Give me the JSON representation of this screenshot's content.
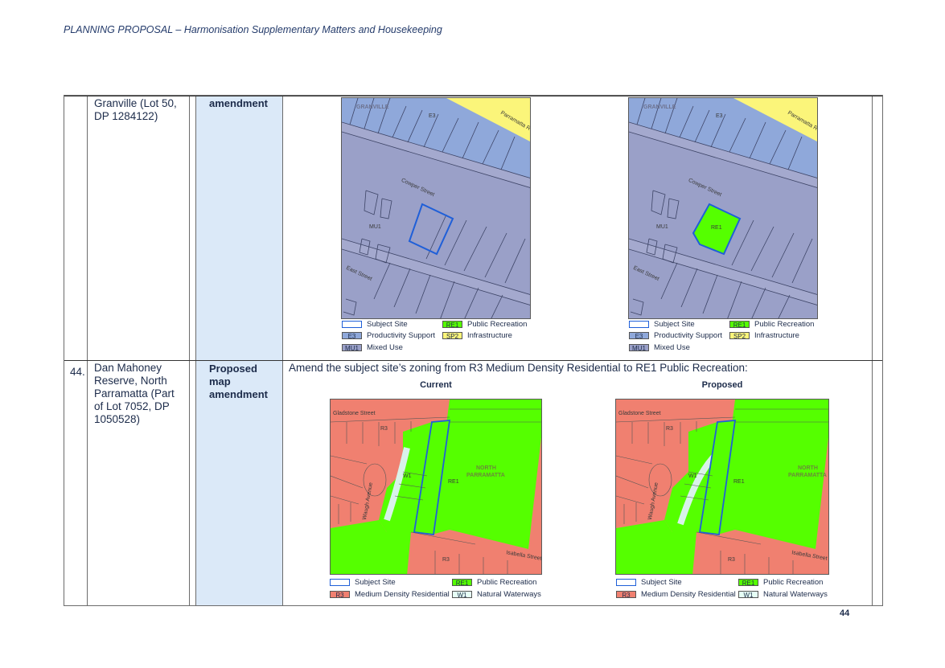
{
  "header": {
    "title": "PLANNING PROPOSAL – Harmonisation Supplementary Matters and Housekeeping"
  },
  "page_number": "44",
  "rows": [
    {
      "number": "",
      "site_lines": [
        "Granville (Lot 50,",
        "DP 1284122)"
      ],
      "type_lines": [
        "amendment"
      ],
      "maps": {
        "current": {
          "labels": {
            "granville": "GRANVILLE",
            "e3": "E3",
            "parramatta": "Parramatta R",
            "cowper": "Cowper Street",
            "mu1": "MU1",
            "east": "East Street"
          }
        },
        "proposed": {
          "labels": {
            "granville": "GRANVILLE",
            "e3": "E3",
            "parramatta": "Parramatta R",
            "cowper": "Cowper Street",
            "mu1": "MU1",
            "re1": "RE1",
            "east": "East Street"
          }
        }
      },
      "legend": {
        "subject_site": "Subject Site",
        "re1_code": "RE1",
        "re1_label": "Public Recreation",
        "e3_code": "E3",
        "e3_label": "Productivity Support",
        "sp2_code": "SP2",
        "sp2_label": "Infrastructure",
        "mu1_code": "MU1",
        "mu1_label": "Mixed Use"
      }
    },
    {
      "number": "44.",
      "site_lines": [
        "Dan Mahoney",
        "Reserve, North",
        "Parramatta (Part",
        "of Lot 7052, DP",
        "1050528)"
      ],
      "type_lines": [
        "Proposed",
        "map",
        "amendment"
      ],
      "description": "Amend the subject site’s zoning from R3 Medium Density Residential to RE1 Public Recreation:",
      "caption_current": "Current",
      "caption_proposed": "Proposed",
      "maps": {
        "current": {
          "labels": {
            "gladstone": "Gladstone Street",
            "r3a": "R3",
            "w1": "W1",
            "re1": "RE1",
            "north": "NORTH",
            "parramatta": "PARRAMATTA",
            "waugh": "Waugh Avenue",
            "r3b": "R3",
            "isabella": "Isabella Street"
          }
        },
        "proposed": {
          "labels": {
            "gladstone": "Gladstone Street",
            "r3a": "R3",
            "w1": "W1",
            "re1": "RE1",
            "north": "NORTH",
            "parramatta": "PARRAMATTA",
            "waugh": "Waugh Avenue",
            "r3b": "R3",
            "isabella": "Isabella Street"
          }
        }
      },
      "legend": {
        "subject_site": "Subject Site",
        "re1_code": "RE1",
        "re1_label": "Public Recreation",
        "r3_code": "R3",
        "r3_label": "Medium Density Residential",
        "w1_code": "W1",
        "w1_label": "Natural Waterways"
      }
    }
  ],
  "colors": {
    "e3": "#8fa8da",
    "mu1": "#9aa0c8",
    "re1": "#55ff00",
    "sp2": "#fbf57a",
    "r3": "#f08070",
    "w1": "#e6fff5",
    "subject": "#1f5fd8",
    "accent_col": "#dbe9f8"
  }
}
